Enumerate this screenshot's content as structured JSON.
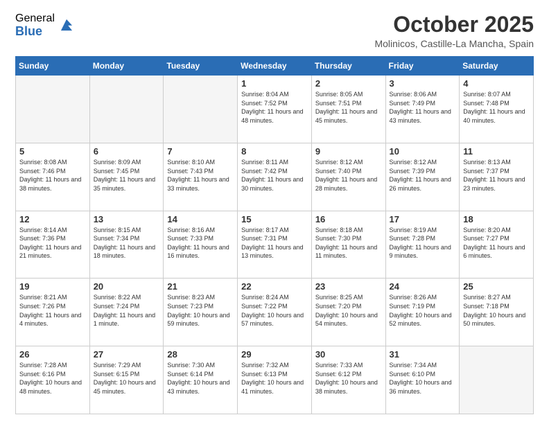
{
  "logo": {
    "general": "General",
    "blue": "Blue"
  },
  "header": {
    "month": "October 2025",
    "location": "Molinicos, Castille-La Mancha, Spain"
  },
  "weekdays": [
    "Sunday",
    "Monday",
    "Tuesday",
    "Wednesday",
    "Thursday",
    "Friday",
    "Saturday"
  ],
  "weeks": [
    [
      {
        "day": "",
        "sunrise": "",
        "sunset": "",
        "daylight": "",
        "empty": true
      },
      {
        "day": "",
        "sunrise": "",
        "sunset": "",
        "daylight": "",
        "empty": true
      },
      {
        "day": "",
        "sunrise": "",
        "sunset": "",
        "daylight": "",
        "empty": true
      },
      {
        "day": "1",
        "sunrise": "8:04 AM",
        "sunset": "7:52 PM",
        "daylight": "11 hours and 48 minutes.",
        "empty": false
      },
      {
        "day": "2",
        "sunrise": "8:05 AM",
        "sunset": "7:51 PM",
        "daylight": "11 hours and 45 minutes.",
        "empty": false
      },
      {
        "day": "3",
        "sunrise": "8:06 AM",
        "sunset": "7:49 PM",
        "daylight": "11 hours and 43 minutes.",
        "empty": false
      },
      {
        "day": "4",
        "sunrise": "8:07 AM",
        "sunset": "7:48 PM",
        "daylight": "11 hours and 40 minutes.",
        "empty": false
      }
    ],
    [
      {
        "day": "5",
        "sunrise": "8:08 AM",
        "sunset": "7:46 PM",
        "daylight": "11 hours and 38 minutes.",
        "empty": false
      },
      {
        "day": "6",
        "sunrise": "8:09 AM",
        "sunset": "7:45 PM",
        "daylight": "11 hours and 35 minutes.",
        "empty": false
      },
      {
        "day": "7",
        "sunrise": "8:10 AM",
        "sunset": "7:43 PM",
        "daylight": "11 hours and 33 minutes.",
        "empty": false
      },
      {
        "day": "8",
        "sunrise": "8:11 AM",
        "sunset": "7:42 PM",
        "daylight": "11 hours and 30 minutes.",
        "empty": false
      },
      {
        "day": "9",
        "sunrise": "8:12 AM",
        "sunset": "7:40 PM",
        "daylight": "11 hours and 28 minutes.",
        "empty": false
      },
      {
        "day": "10",
        "sunrise": "8:12 AM",
        "sunset": "7:39 PM",
        "daylight": "11 hours and 26 minutes.",
        "empty": false
      },
      {
        "day": "11",
        "sunrise": "8:13 AM",
        "sunset": "7:37 PM",
        "daylight": "11 hours and 23 minutes.",
        "empty": false
      }
    ],
    [
      {
        "day": "12",
        "sunrise": "8:14 AM",
        "sunset": "7:36 PM",
        "daylight": "11 hours and 21 minutes.",
        "empty": false
      },
      {
        "day": "13",
        "sunrise": "8:15 AM",
        "sunset": "7:34 PM",
        "daylight": "11 hours and 18 minutes.",
        "empty": false
      },
      {
        "day": "14",
        "sunrise": "8:16 AM",
        "sunset": "7:33 PM",
        "daylight": "11 hours and 16 minutes.",
        "empty": false
      },
      {
        "day": "15",
        "sunrise": "8:17 AM",
        "sunset": "7:31 PM",
        "daylight": "11 hours and 13 minutes.",
        "empty": false
      },
      {
        "day": "16",
        "sunrise": "8:18 AM",
        "sunset": "7:30 PM",
        "daylight": "11 hours and 11 minutes.",
        "empty": false
      },
      {
        "day": "17",
        "sunrise": "8:19 AM",
        "sunset": "7:28 PM",
        "daylight": "11 hours and 9 minutes.",
        "empty": false
      },
      {
        "day": "18",
        "sunrise": "8:20 AM",
        "sunset": "7:27 PM",
        "daylight": "11 hours and 6 minutes.",
        "empty": false
      }
    ],
    [
      {
        "day": "19",
        "sunrise": "8:21 AM",
        "sunset": "7:26 PM",
        "daylight": "11 hours and 4 minutes.",
        "empty": false
      },
      {
        "day": "20",
        "sunrise": "8:22 AM",
        "sunset": "7:24 PM",
        "daylight": "11 hours and 1 minute.",
        "empty": false
      },
      {
        "day": "21",
        "sunrise": "8:23 AM",
        "sunset": "7:23 PM",
        "daylight": "10 hours and 59 minutes.",
        "empty": false
      },
      {
        "day": "22",
        "sunrise": "8:24 AM",
        "sunset": "7:22 PM",
        "daylight": "10 hours and 57 minutes.",
        "empty": false
      },
      {
        "day": "23",
        "sunrise": "8:25 AM",
        "sunset": "7:20 PM",
        "daylight": "10 hours and 54 minutes.",
        "empty": false
      },
      {
        "day": "24",
        "sunrise": "8:26 AM",
        "sunset": "7:19 PM",
        "daylight": "10 hours and 52 minutes.",
        "empty": false
      },
      {
        "day": "25",
        "sunrise": "8:27 AM",
        "sunset": "7:18 PM",
        "daylight": "10 hours and 50 minutes.",
        "empty": false
      }
    ],
    [
      {
        "day": "26",
        "sunrise": "7:28 AM",
        "sunset": "6:16 PM",
        "daylight": "10 hours and 48 minutes.",
        "empty": false
      },
      {
        "day": "27",
        "sunrise": "7:29 AM",
        "sunset": "6:15 PM",
        "daylight": "10 hours and 45 minutes.",
        "empty": false
      },
      {
        "day": "28",
        "sunrise": "7:30 AM",
        "sunset": "6:14 PM",
        "daylight": "10 hours and 43 minutes.",
        "empty": false
      },
      {
        "day": "29",
        "sunrise": "7:32 AM",
        "sunset": "6:13 PM",
        "daylight": "10 hours and 41 minutes.",
        "empty": false
      },
      {
        "day": "30",
        "sunrise": "7:33 AM",
        "sunset": "6:12 PM",
        "daylight": "10 hours and 38 minutes.",
        "empty": false
      },
      {
        "day": "31",
        "sunrise": "7:34 AM",
        "sunset": "6:10 PM",
        "daylight": "10 hours and 36 minutes.",
        "empty": false
      },
      {
        "day": "",
        "sunrise": "",
        "sunset": "",
        "daylight": "",
        "empty": true
      }
    ]
  ]
}
